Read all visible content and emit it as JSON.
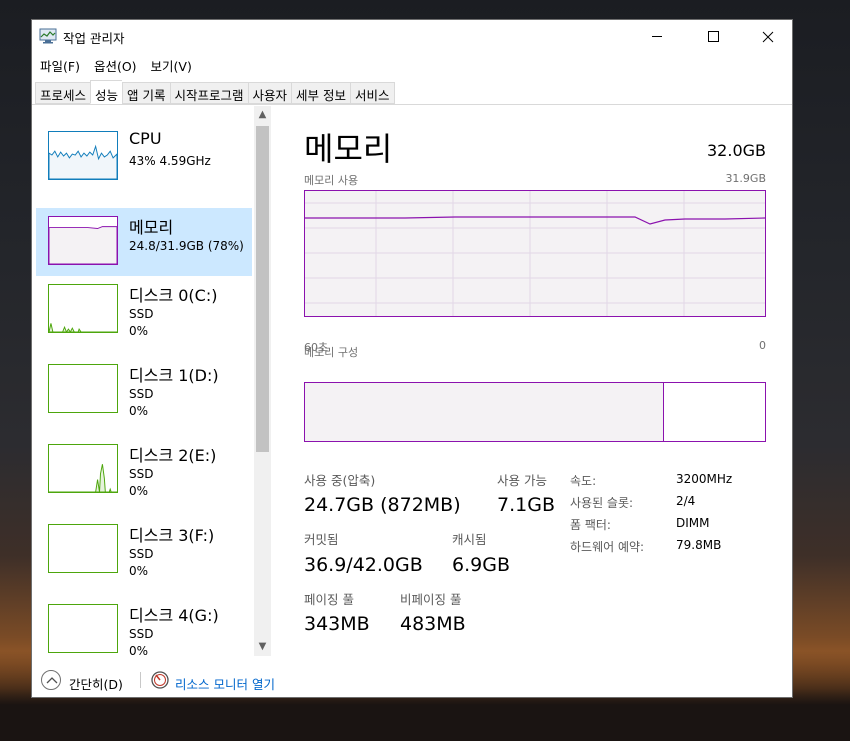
{
  "window": {
    "title": "작업 관리자"
  },
  "menu": [
    "파일(F)",
    "옵션(O)",
    "보기(V)"
  ],
  "tabs": [
    {
      "label": "프로세스",
      "active": false
    },
    {
      "label": "성능",
      "active": true
    },
    {
      "label": "앱 기록",
      "active": false
    },
    {
      "label": "시작프로그램",
      "active": false
    },
    {
      "label": "사용자",
      "active": false
    },
    {
      "label": "세부 정보",
      "active": false
    },
    {
      "label": "서비스",
      "active": false
    }
  ],
  "sidebar": {
    "items": [
      {
        "name": "CPU",
        "line1": "43%  4.59GHz",
        "line2": "",
        "type": "cpu",
        "selected": false
      },
      {
        "name": "메모리",
        "line1": "24.8/31.9GB (78%)",
        "line2": "",
        "type": "memory",
        "selected": true
      },
      {
        "name": "디스크 0(C:)",
        "line1": "SSD",
        "line2": "0%",
        "type": "disk",
        "selected": false
      },
      {
        "name": "디스크 1(D:)",
        "line1": "SSD",
        "line2": "0%",
        "type": "disk",
        "selected": false
      },
      {
        "name": "디스크 2(E:)",
        "line1": "SSD",
        "line2": "0%",
        "type": "disk",
        "selected": false
      },
      {
        "name": "디스크 3(F:)",
        "line1": "SSD",
        "line2": "0%",
        "type": "disk",
        "selected": false
      },
      {
        "name": "디스크 4(G:)",
        "line1": "SSD",
        "line2": "0%",
        "type": "disk",
        "selected": false
      }
    ]
  },
  "main": {
    "title": "메모리",
    "total": "32.0GB",
    "usage_label": "메모리 사용",
    "usage_max": "31.9GB",
    "axis_left": "60초",
    "axis_right": "0",
    "composition_label": "메모리 구성",
    "composition": {
      "in_use_fraction": 0.78,
      "standby_fraction": 0.21,
      "free_fraction": 0.01
    },
    "stats": {
      "in_use_label": "사용 중(압축)",
      "in_use_value": "24.7GB (872MB)",
      "available_label": "사용 가능",
      "available_value": "7.1GB",
      "committed_label": "커밋됨",
      "committed_value": "36.9/42.0GB",
      "cached_label": "캐시됨",
      "cached_value": "6.9GB",
      "paged_label": "페이징 풀",
      "paged_value": "343MB",
      "nonpaged_label": "비페이징 풀",
      "nonpaged_value": "483MB"
    },
    "details": [
      {
        "label": "속도:",
        "value": "3200MHz"
      },
      {
        "label": "사용된 슬롯:",
        "value": "2/4"
      },
      {
        "label": "폼 팩터:",
        "value": "DIMM"
      },
      {
        "label": "하드웨어 예약:",
        "value": "79.8MB"
      }
    ]
  },
  "footer": {
    "fewer_details": "간단히(D)",
    "resource_monitor": "리소스 모니터 열기"
  },
  "colors": {
    "memory": "#8b12ae",
    "cpu": "#117dbb",
    "disk": "#4da60c",
    "selected_bg": "#cce8ff",
    "link": "#0066cc"
  }
}
